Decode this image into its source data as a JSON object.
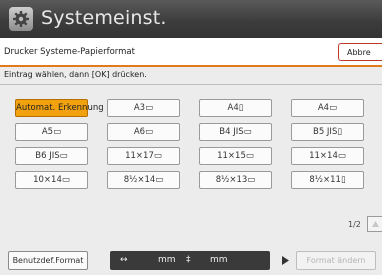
{
  "window": {
    "title": "Systemeinst."
  },
  "header": {
    "title": "Drucker Systeme-Papierformat",
    "abort_label": "Abbre"
  },
  "instruction": "Eintrag wählen, dann [OK] drücken.",
  "formats": [
    {
      "label": "Automat. Erkennung",
      "selected": true
    },
    {
      "label": "A3▭",
      "selected": false
    },
    {
      "label": "A4▯",
      "selected": false
    },
    {
      "label": "A4▭",
      "selected": false
    },
    {
      "label": "A5▭",
      "selected": false
    },
    {
      "label": "A6▭",
      "selected": false
    },
    {
      "label": "B4 JIS▭",
      "selected": false
    },
    {
      "label": "B5 JIS▯",
      "selected": false
    },
    {
      "label": "B6 JIS▭",
      "selected": false
    },
    {
      "label": "11×17▭",
      "selected": false
    },
    {
      "label": "11×15▭",
      "selected": false
    },
    {
      "label": "11×14▭",
      "selected": false
    },
    {
      "label": "10×14▭",
      "selected": false
    },
    {
      "label": "8½×14▭",
      "selected": false
    },
    {
      "label": "8½×13▭",
      "selected": false
    },
    {
      "label": "8½×11▯",
      "selected": false
    }
  ],
  "pagination": {
    "indicator": "1/2"
  },
  "bottom": {
    "custom_format_label": "Benutzdef.Format",
    "dim_prefix": "↔",
    "dim_width_unit": "mm",
    "dim_sep": "‡",
    "dim_height_unit": "mm",
    "convert_label": "Format ändern"
  },
  "colors": {
    "accent": "#e07a1e",
    "selected": "#f3a20f",
    "titlebar": "#3d3d3d"
  }
}
